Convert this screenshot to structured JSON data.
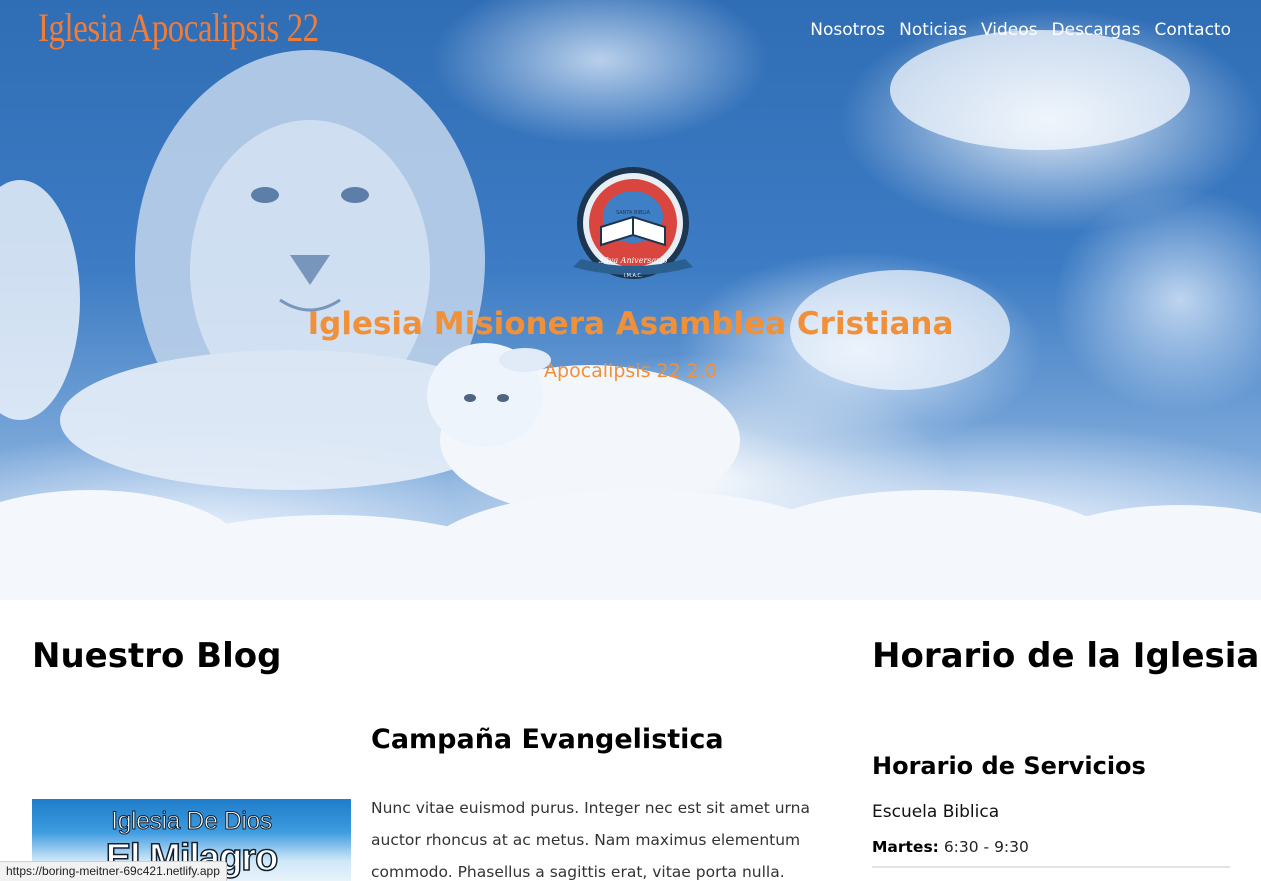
{
  "header": {
    "brand": "Iglesia Apocalipsis 22",
    "nav": [
      "Nosotros",
      "Noticias",
      "Videos",
      "Descargas",
      "Contacto"
    ]
  },
  "hero": {
    "title": "Iglesia Misionera Asamblea Cristiana",
    "subtitle": "Apocalipsis 22 2.0",
    "emblem": {
      "book_text": "SANTA BIBLIA",
      "ribbon_text": "38va Aniversario",
      "initials": "I.M.A.C."
    }
  },
  "blog": {
    "heading": "Nuestro Blog",
    "post": {
      "title": "Campaña Evangelistica",
      "excerpt": "Nunc vitae euismod purus. Integer nec est sit amet urna auctor rhoncus at ac metus. Nam maximus elementum commodo. Phasellus a sagittis erat, vitae porta nulla. Vivamus",
      "thumbnail_line1": "Iglesia De Dios",
      "thumbnail_line2": "El Milagro"
    }
  },
  "schedule": {
    "heading": "Horario de la Iglesia",
    "services_heading": "Horario de Servicios",
    "items": [
      {
        "name": "Escuela Biblica",
        "day": "Martes:",
        "time": "6:30 - 9:30"
      }
    ]
  },
  "status_bar": {
    "url": "https://boring-meitner-69c421.netlify.app"
  },
  "colors": {
    "accent": "#f0913a",
    "brand": "#f07c3a",
    "sky": "#2f6db5"
  }
}
